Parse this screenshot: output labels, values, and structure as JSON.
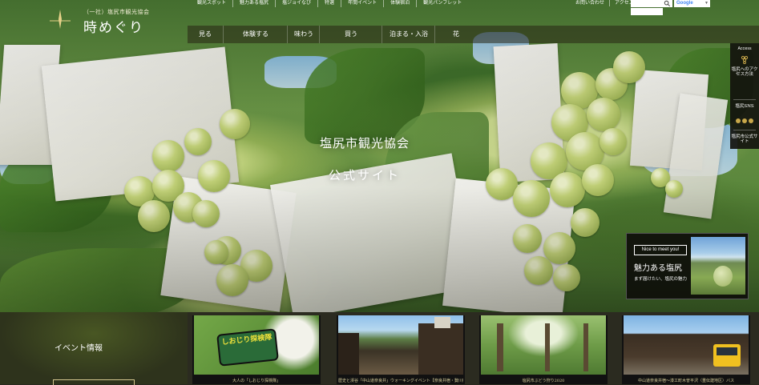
{
  "logo": {
    "small": "（一社）塩尻市観光協会",
    "big": "時めぐり"
  },
  "topnav": [
    "観光スポット",
    "魅力ある塩尻",
    "塩ジョイなび",
    "特選",
    "年間イベント",
    "体験宿泊",
    "観光パンフレット"
  ],
  "util": [
    "お問い合わせ",
    "アクセス"
  ],
  "search": {
    "placeholder": "",
    "google_label": "Google"
  },
  "mainnav": [
    "見る",
    "体験する",
    "味わう",
    "買う",
    "泊まる・入浴",
    "花"
  ],
  "hero": {
    "line1": "塩尻市観光協会",
    "line2": "公式サイト"
  },
  "sidebar": {
    "access": "Access",
    "access_text": "塩尻へのアクセス方法",
    "sns_label": "塩尻SNS",
    "official_text": "塩尻市公式サイト"
  },
  "promo": {
    "tag": "Nice to meet you!",
    "title": "魅力ある塩尻",
    "sub": "まず届けたい、塩尻の魅力"
  },
  "events": {
    "title": "イベント情報",
    "cards": [
      {
        "caption": "大人の「しおじり探検隊」",
        "img_text": "しおじり探検隊"
      },
      {
        "caption": "歴史と渓谷「中山道奈良井」ウォーキングイベント【奈良井宿・贄川宿】",
        "img_text": ""
      },
      {
        "caption": "塩尻市ぶどう狩り2020",
        "img_text": ""
      },
      {
        "caption": "中山道奈良井宿～漆工町木曽平沢（重伝建地区）バス",
        "img_text": ""
      }
    ]
  },
  "colors": {
    "accent": "#c9a84a",
    "dark": "#2b2b20"
  }
}
